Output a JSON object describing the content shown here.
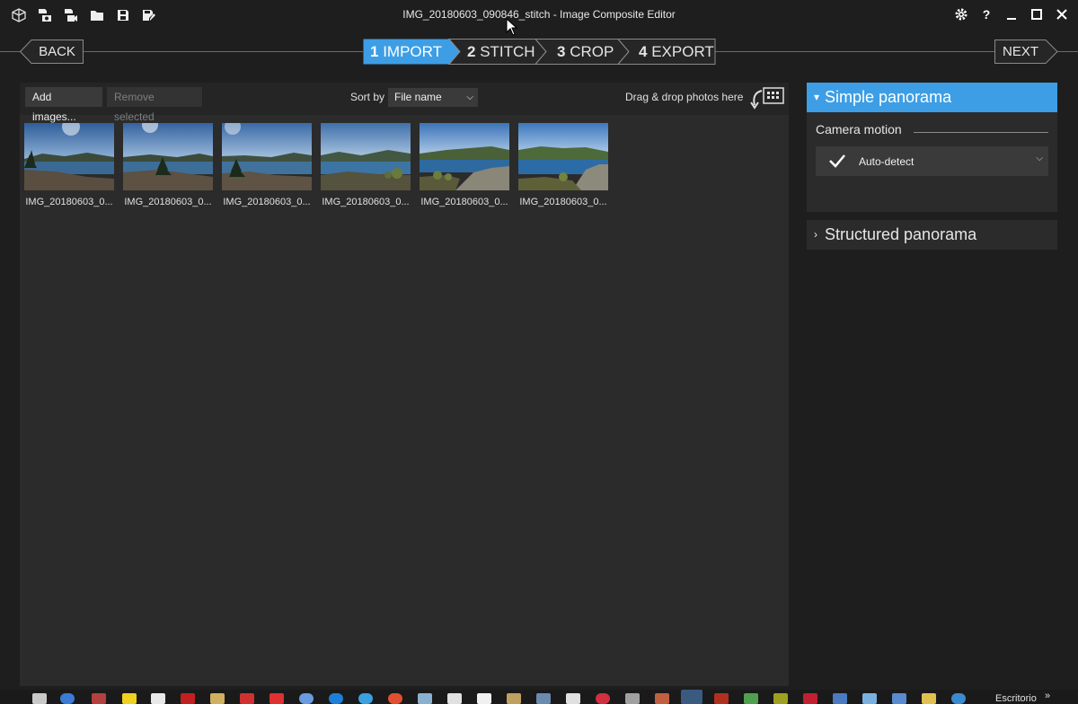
{
  "window": {
    "title": "IMG_20180603_090846_stitch - Image Composite Editor",
    "toolbar_icons": [
      "new-project-icon",
      "new-panorama-from-images-icon",
      "new-panorama-from-video-icon",
      "open-folder-icon",
      "save-icon",
      "save-as-icon"
    ],
    "controls": [
      "settings-icon",
      "help-icon",
      "minimize-icon",
      "maximize-icon",
      "close-icon"
    ],
    "help_label": "?"
  },
  "wizard": {
    "back_label": "BACK",
    "next_label": "NEXT",
    "steps": [
      {
        "num": "1",
        "label": "IMPORT",
        "active": true
      },
      {
        "num": "2",
        "label": "STITCH",
        "active": false
      },
      {
        "num": "3",
        "label": "CROP",
        "active": false
      },
      {
        "num": "4",
        "label": "EXPORT",
        "active": false
      }
    ]
  },
  "import_toolbar": {
    "add_images_label": "Add images...",
    "remove_selected_label": "Remove selected",
    "sort_label": "Sort by",
    "sort_value": "File name",
    "drag_drop_text": "Drag & drop photos here"
  },
  "thumbnails": [
    {
      "label": "IMG_20180603_0..."
    },
    {
      "label": "IMG_20180603_0..."
    },
    {
      "label": "IMG_20180603_0..."
    },
    {
      "label": "IMG_20180603_0..."
    },
    {
      "label": "IMG_20180603_0..."
    },
    {
      "label": "IMG_20180603_0..."
    }
  ],
  "panel": {
    "simple_panorama_label": "Simple panorama",
    "camera_motion_label": "Camera motion",
    "camera_motion_value": "Auto-detect",
    "structured_panorama_label": "Structured panorama"
  },
  "taskbar": {
    "desktop_label": "Escritorio",
    "overflow_chevron": "»"
  },
  "colors": {
    "accent": "#3d9ee5",
    "background": "#1e1e1e",
    "panel": "#2b2b2b"
  }
}
